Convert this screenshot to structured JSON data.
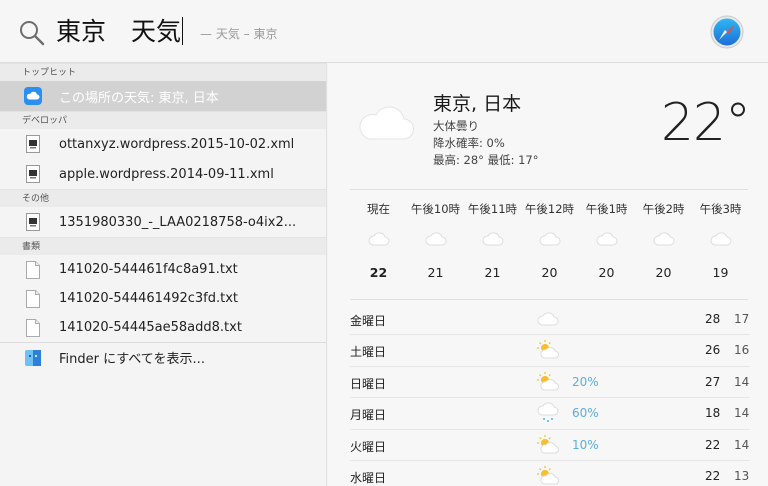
{
  "search": {
    "query": "東京　天気",
    "suggestion": "— 天気 – 東京"
  },
  "results": {
    "sections": [
      {
        "header": "トップヒット",
        "items": [
          {
            "label": "この場所の天気: 東京, 日本",
            "icon": "cloud-app-icon",
            "selected": true
          }
        ]
      },
      {
        "header": "デベロッパ",
        "items": [
          {
            "label": "ottanxyz.wordpress.2015-10-02.xml",
            "icon": "xml-file-icon"
          },
          {
            "label": "apple.wordpress.2014-09-11.xml",
            "icon": "xml-file-icon"
          }
        ]
      },
      {
        "header": "その他",
        "items": [
          {
            "label": "1351980330_-_LAA0218758-o4ix2...",
            "icon": "file-icon"
          }
        ]
      },
      {
        "header": "書類",
        "items": [
          {
            "label": "141020-544461f4c8a91.txt",
            "icon": "text-file-icon"
          },
          {
            "label": "141020-544461492c3fd.txt",
            "icon": "text-file-icon"
          },
          {
            "label": "141020-54445ae58add8.txt",
            "icon": "text-file-icon"
          }
        ]
      }
    ],
    "footer": {
      "label": "Finder にすべてを表示...",
      "icon": "finder-icon"
    }
  },
  "weather": {
    "city": "東京, 日本",
    "condition": "大体曇り",
    "precip": "降水確率: 0%",
    "highlow": "最高: 28°  最低: 17°",
    "temp": "22°",
    "hourly": [
      {
        "label": "現在",
        "temp": "22",
        "icon": "cloud-icon"
      },
      {
        "label": "午後10時",
        "temp": "21",
        "icon": "cloud-icon"
      },
      {
        "label": "午後11時",
        "temp": "21",
        "icon": "cloud-icon"
      },
      {
        "label": "午後12時",
        "temp": "20",
        "icon": "cloud-icon"
      },
      {
        "label": "午後1時",
        "temp": "20",
        "icon": "cloud-icon"
      },
      {
        "label": "午後2時",
        "temp": "20",
        "icon": "cloud-icon"
      },
      {
        "label": "午後3時",
        "temp": "19",
        "icon": "cloud-icon"
      }
    ],
    "daily": [
      {
        "day": "金曜日",
        "icon": "cloud-icon",
        "chance": "",
        "high": "28",
        "low": "17"
      },
      {
        "day": "土曜日",
        "icon": "partly-sunny-icon",
        "chance": "",
        "high": "26",
        "low": "16"
      },
      {
        "day": "日曜日",
        "icon": "partly-sunny-icon",
        "chance": "20%",
        "high": "27",
        "low": "14"
      },
      {
        "day": "月曜日",
        "icon": "rain-icon",
        "chance": "60%",
        "high": "18",
        "low": "14"
      },
      {
        "day": "火曜日",
        "icon": "partly-sunny-icon",
        "chance": "10%",
        "high": "22",
        "low": "14"
      },
      {
        "day": "水曜日",
        "icon": "partly-sunny-icon",
        "chance": "",
        "high": "22",
        "low": "13"
      }
    ]
  },
  "colors": {
    "selection": "#d2d2d2",
    "precip_blue": "#5aaee0",
    "sun": "#f5c02a"
  }
}
